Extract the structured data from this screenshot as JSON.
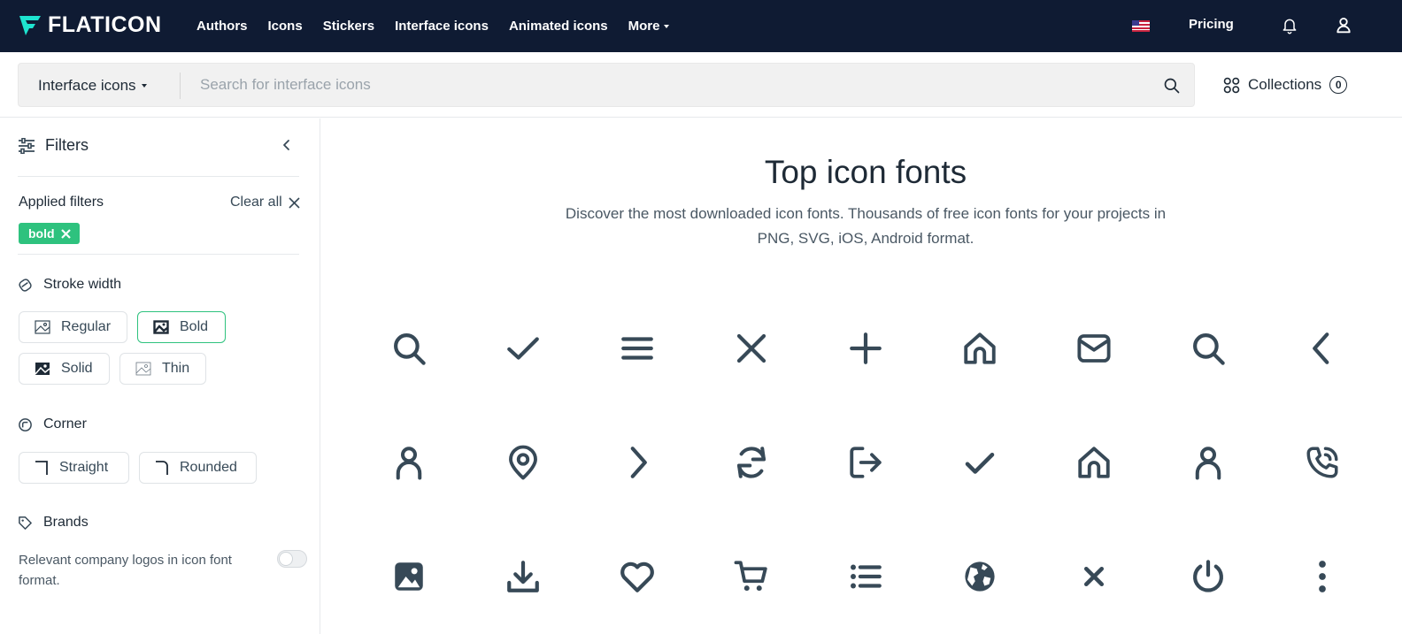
{
  "brand": {
    "name": "FLATICON"
  },
  "nav": {
    "links": [
      "Authors",
      "Icons",
      "Stickers",
      "Interface icons",
      "Animated icons"
    ],
    "more": "More",
    "pricing": "Pricing"
  },
  "search": {
    "type": "Interface icons",
    "placeholder": "Search for interface icons",
    "collections_label": "Collections",
    "collections_count": "0"
  },
  "sidebar": {
    "title": "Filters",
    "applied_label": "Applied filters",
    "clear_all": "Clear all",
    "chip": "bold",
    "stroke_title": "Stroke width",
    "stroke_options": [
      "Regular",
      "Bold",
      "Solid",
      "Thin"
    ],
    "stroke_selected": "Bold",
    "corner_title": "Corner",
    "corner_options": [
      "Straight",
      "Rounded"
    ],
    "brands_title": "Brands",
    "brands_desc": "Relevant company logos in icon font format.",
    "brands_toggle": false
  },
  "main": {
    "title": "Top icon fonts",
    "description": "Discover the most downloaded icon fonts. Thousands of free icon fonts for your projects in PNG, SVG, iOS, Android format.",
    "icons": [
      "search-icon",
      "check-icon",
      "menu-icon",
      "close-icon",
      "plus-icon",
      "home-icon",
      "envelope-icon",
      "search-icon",
      "chevron-left-icon",
      "user-icon",
      "location-pin-icon",
      "chevron-right-icon",
      "refresh-icon",
      "sign-out-icon",
      "check-icon",
      "home-icon",
      "user-icon",
      "phone-call-icon",
      "picture-icon",
      "download-icon",
      "heart-icon",
      "shopping-cart-icon",
      "list-icon",
      "globe-icon",
      "cross-small-icon",
      "power-icon",
      "menu-dots-vertical-icon"
    ],
    "icon_color": "#374957"
  },
  "colors": {
    "nav_bg": "#0f1b33",
    "accent": "#2ec27e",
    "text": "#1e2a36"
  }
}
